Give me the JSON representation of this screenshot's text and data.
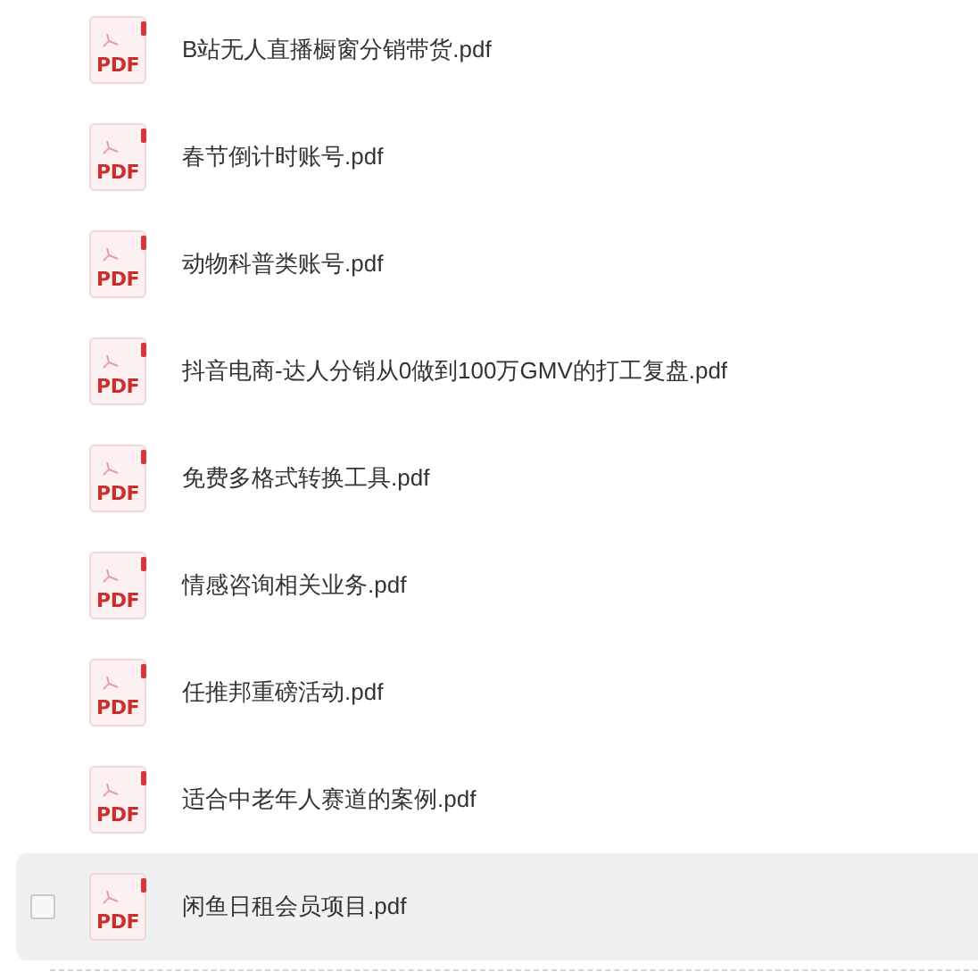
{
  "files": [
    {
      "name": "B站无人直播橱窗分销带货.pdf",
      "type_label": "PDF",
      "highlighted": false
    },
    {
      "name": "春节倒计时账号.pdf",
      "type_label": "PDF",
      "highlighted": false
    },
    {
      "name": "动物科普类账号.pdf",
      "type_label": "PDF",
      "highlighted": false
    },
    {
      "name": "抖音电商-达人分销从0做到100万GMV的打工复盘.pdf",
      "type_label": "PDF",
      "highlighted": false
    },
    {
      "name": "免费多格式转换工具.pdf",
      "type_label": "PDF",
      "highlighted": false
    },
    {
      "name": "情感咨询相关业务.pdf",
      "type_label": "PDF",
      "highlighted": false
    },
    {
      "name": "任推邦重磅活动.pdf",
      "type_label": "PDF",
      "highlighted": false
    },
    {
      "name": "适合中老年人赛道的案例.pdf",
      "type_label": "PDF",
      "highlighted": false
    },
    {
      "name": "闲鱼日租会员项目.pdf",
      "type_label": "PDF",
      "highlighted": true
    }
  ]
}
